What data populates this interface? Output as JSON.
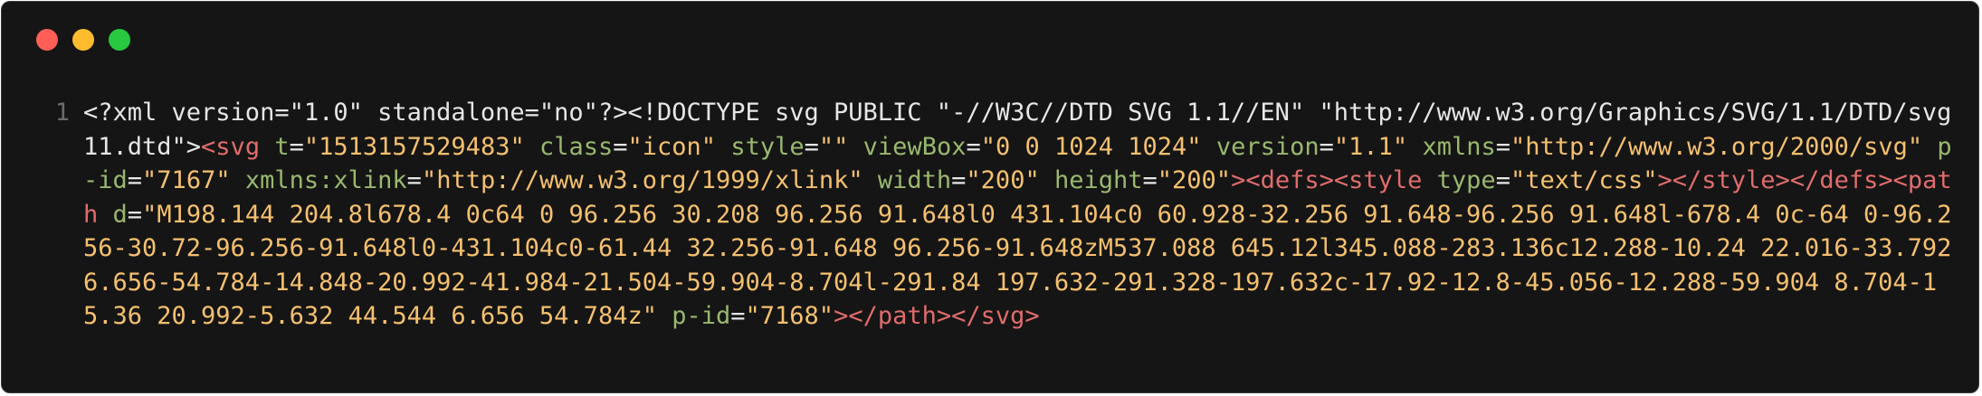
{
  "window": {
    "controls": [
      {
        "name": "close",
        "color": "#ff5f57"
      },
      {
        "name": "minimize",
        "color": "#febc2e"
      },
      {
        "name": "zoom",
        "color": "#28c840"
      }
    ]
  },
  "editor": {
    "line_number": "1",
    "tokens": [
      {
        "t": "<?xml version=\"1.0\" standalone=\"no\"?><!DOCTYPE svg PUBLIC \"-//W3C//DTD SVG 1.1//EN\" \"http://www.w3.org/Graphics/SVG/1.1/DTD/svg11.dtd\">",
        "c": "plain"
      },
      {
        "t": "<svg",
        "c": "tag"
      },
      {
        "t": " ",
        "c": "plain"
      },
      {
        "t": "t",
        "c": "attr"
      },
      {
        "t": "=",
        "c": "plain"
      },
      {
        "t": "\"1513157529483\"",
        "c": "str"
      },
      {
        "t": " ",
        "c": "plain"
      },
      {
        "t": "class",
        "c": "attr"
      },
      {
        "t": "=",
        "c": "plain"
      },
      {
        "t": "\"icon\"",
        "c": "str"
      },
      {
        "t": " ",
        "c": "plain"
      },
      {
        "t": "style",
        "c": "attr"
      },
      {
        "t": "=",
        "c": "plain"
      },
      {
        "t": "\"\"",
        "c": "str"
      },
      {
        "t": " ",
        "c": "plain"
      },
      {
        "t": "viewBox",
        "c": "attr"
      },
      {
        "t": "=",
        "c": "plain"
      },
      {
        "t": "\"0 0 1024 1024\"",
        "c": "str"
      },
      {
        "t": " ",
        "c": "plain"
      },
      {
        "t": "version",
        "c": "attr"
      },
      {
        "t": "=",
        "c": "plain"
      },
      {
        "t": "\"1.1\"",
        "c": "str"
      },
      {
        "t": " ",
        "c": "plain"
      },
      {
        "t": "xmlns",
        "c": "attr"
      },
      {
        "t": "=",
        "c": "plain"
      },
      {
        "t": "\"http://www.w3.org/2000/svg\"",
        "c": "str"
      },
      {
        "t": " ",
        "c": "plain"
      },
      {
        "t": "p-id",
        "c": "attr"
      },
      {
        "t": "=",
        "c": "plain"
      },
      {
        "t": "\"7167\"",
        "c": "str"
      },
      {
        "t": " ",
        "c": "plain"
      },
      {
        "t": "xmlns:xlink",
        "c": "attr"
      },
      {
        "t": "=",
        "c": "plain"
      },
      {
        "t": "\"http://www.w3.org/1999/xlink\"",
        "c": "str"
      },
      {
        "t": " ",
        "c": "plain"
      },
      {
        "t": "width",
        "c": "attr"
      },
      {
        "t": "=",
        "c": "plain"
      },
      {
        "t": "\"200\"",
        "c": "str"
      },
      {
        "t": " ",
        "c": "plain"
      },
      {
        "t": "height",
        "c": "attr"
      },
      {
        "t": "=",
        "c": "plain"
      },
      {
        "t": "\"200\"",
        "c": "str"
      },
      {
        "t": "><defs><style",
        "c": "tag"
      },
      {
        "t": " ",
        "c": "plain"
      },
      {
        "t": "type",
        "c": "attr"
      },
      {
        "t": "=",
        "c": "plain"
      },
      {
        "t": "\"text/css\"",
        "c": "str"
      },
      {
        "t": "></style></defs><path",
        "c": "tag"
      },
      {
        "t": " ",
        "c": "plain"
      },
      {
        "t": "d",
        "c": "attr"
      },
      {
        "t": "=",
        "c": "plain"
      },
      {
        "t": "\"M198.144 204.8l678.4 0c64 0 96.256 30.208 96.256 91.648l0 431.104c0 60.928-32.256 91.648-96.256 91.648l-678.4 0c-64 0-96.256-30.72-96.256-91.648l0-431.104c0-61.44 32.256-91.648 96.256-91.648zM537.088 645.12l345.088-283.136c12.288-10.24 22.016-33.792 6.656-54.784-14.848-20.992-41.984-21.504-59.904-8.704l-291.84 197.632-291.328-197.632c-17.92-12.8-45.056-12.288-59.904 8.704-15.36 20.992-5.632 44.544 6.656 54.784z\"",
        "c": "str"
      },
      {
        "t": " ",
        "c": "plain"
      },
      {
        "t": "p-id",
        "c": "attr"
      },
      {
        "t": "=",
        "c": "plain"
      },
      {
        "t": "\"7168\"",
        "c": "str"
      },
      {
        "t": "></path></svg>",
        "c": "tag"
      }
    ]
  }
}
